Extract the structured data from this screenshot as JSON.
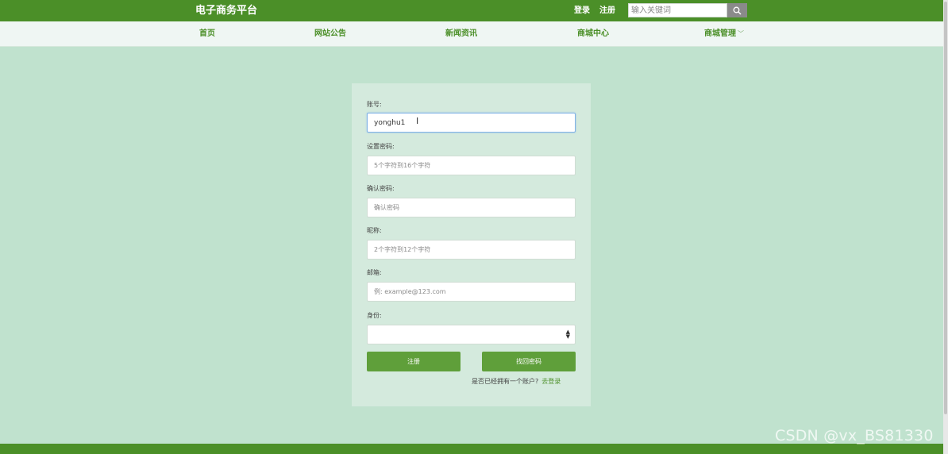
{
  "header": {
    "brand": "电子商务平台",
    "login_label": "登录",
    "register_label": "注册",
    "search_placeholder": "输入关键词",
    "search_icon": "search-icon"
  },
  "nav": {
    "items": [
      {
        "label": "首页"
      },
      {
        "label": "网站公告"
      },
      {
        "label": "新闻资讯"
      },
      {
        "label": "商城中心"
      },
      {
        "label": "商城管理"
      }
    ],
    "dropdown_icon": "chevron-down-icon"
  },
  "form": {
    "account_label": "账号:",
    "account_value": "yonghu1",
    "password_label": "设置密码:",
    "password_placeholder": "5个字符到16个字符",
    "confirm_label": "确认密码:",
    "confirm_placeholder": "确认密码",
    "nickname_label": "昵称:",
    "nickname_placeholder": "2个字符到12个字符",
    "email_label": "邮箱:",
    "email_placeholder": "例: example@123.com",
    "identity_label": "身份:",
    "identity_value": "",
    "register_button": "注册",
    "recover_button": "找回密码",
    "account_question": "是否已经拥有一个账户?",
    "login_link": "去登录"
  },
  "watermark": "CSDN @vx_BS81330",
  "colors": {
    "header_green": "#4b8f28",
    "page_bg": "#c0e2ce",
    "button_green": "#5f9f3a"
  }
}
